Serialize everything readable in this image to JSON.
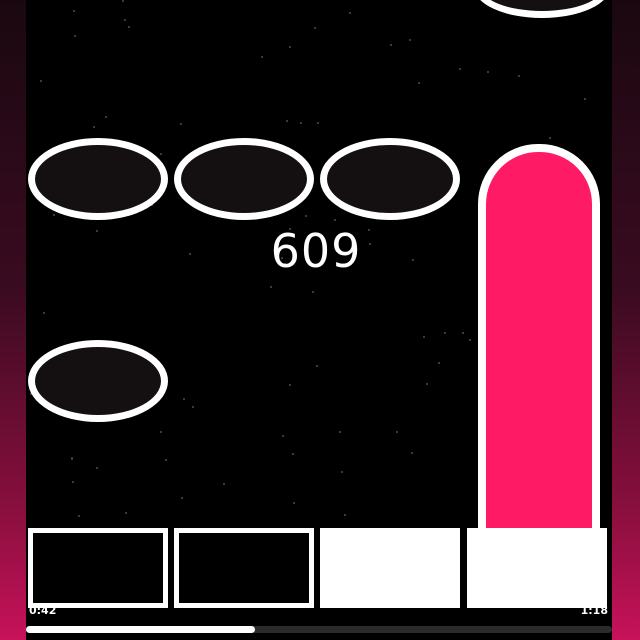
{
  "game": {
    "score": "609",
    "accent_color": "#ff1a66",
    "lanes": [
      {
        "pad": "empty"
      },
      {
        "pad": "empty"
      },
      {
        "pad": "filled"
      },
      {
        "pad": "filled"
      }
    ]
  },
  "playback": {
    "elapsed": "0:42",
    "total": "1:18",
    "progress": 0.39
  }
}
